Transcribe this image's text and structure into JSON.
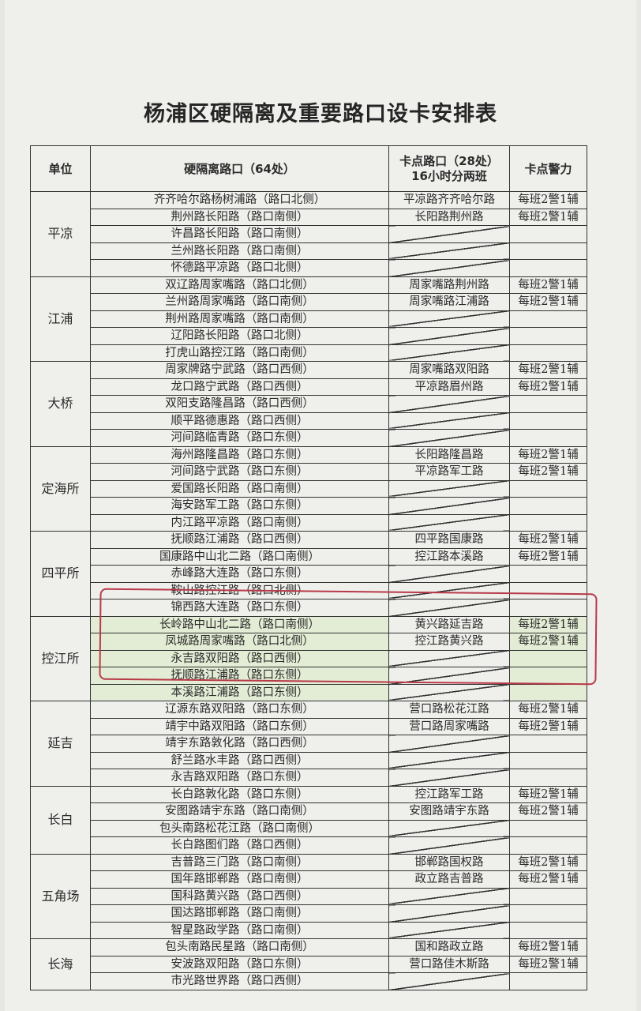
{
  "title": "杨浦区硬隔离及重要路口设卡安排表",
  "headers": {
    "unit": "单位",
    "road": "硬隔离路口（64处）",
    "checkpoint_line1": "卡点路口（28处）",
    "checkpoint_line2": "16小时分两班",
    "police": "卡点警力"
  },
  "groups": [
    {
      "unit": "平凉",
      "rows": [
        {
          "road": "齐齐哈尔路杨树浦路（路口北侧）",
          "cp": "平凉路齐齐哈尔路",
          "police": "每班2警1辅"
        },
        {
          "road": "荆州路长阳路（路口南侧）",
          "cp": "长阳路荆州路",
          "police": "每班2警1辅"
        },
        {
          "road": "许昌路长阳路（路口南侧）",
          "cp": "",
          "police": ""
        },
        {
          "road": "兰州路长阳路（路口南侧）",
          "cp": "",
          "police": ""
        },
        {
          "road": "怀德路平凉路（路口北侧）",
          "cp": "",
          "police": ""
        }
      ]
    },
    {
      "unit": "江浦",
      "rows": [
        {
          "road": "双辽路周家嘴路（路口北侧）",
          "cp": "周家嘴路荆州路",
          "police": "每班2警1辅"
        },
        {
          "road": "兰州路周家嘴路（路口南侧）",
          "cp": "周家嘴路江浦路",
          "police": "每班2警1辅"
        },
        {
          "road": "荆州路周家嘴路（路口南侧）",
          "cp": "",
          "police": ""
        },
        {
          "road": "辽阳路长阳路（路口北侧）",
          "cp": "",
          "police": ""
        },
        {
          "road": "打虎山路控江路（路口南侧）",
          "cp": "",
          "police": ""
        }
      ]
    },
    {
      "unit": "大桥",
      "rows": [
        {
          "road": "周家牌路宁武路（路口西侧）",
          "cp": "周家嘴路双阳路",
          "police": "每班2警1辅"
        },
        {
          "road": "龙口路宁武路（路口西侧）",
          "cp": "平凉路眉州路",
          "police": "每班2警1辅"
        },
        {
          "road": "双阳支路隆昌路（路口西侧）",
          "cp": "",
          "police": ""
        },
        {
          "road": "顺平路德惠路（路口西侧）",
          "cp": "",
          "police": ""
        },
        {
          "road": "河间路临青路（路口东侧）",
          "cp": "",
          "police": ""
        }
      ]
    },
    {
      "unit": "定海所",
      "rows": [
        {
          "road": "海州路隆昌路（路口东侧）",
          "cp": "长阳路隆昌路",
          "police": "每班2警1辅"
        },
        {
          "road": "河间路宁武路（路口东侧）",
          "cp": "平凉路军工路",
          "police": "每班2警1辅"
        },
        {
          "road": "爱国路长阳路（路口南侧）",
          "cp": "",
          "police": ""
        },
        {
          "road": "海安路军工路（路口东侧）",
          "cp": "",
          "police": ""
        },
        {
          "road": "内江路平凉路（路口南侧）",
          "cp": "",
          "police": ""
        }
      ]
    },
    {
      "unit": "四平所",
      "rows": [
        {
          "road": "抚顺路江浦路（路口西侧）",
          "cp": "四平路国康路",
          "police": "每班2警1辅"
        },
        {
          "road": "国康路中山北二路（路口南侧）",
          "cp": "控江路本溪路",
          "police": "每班2警1辅"
        },
        {
          "road": "赤峰路大连路（路口东侧）",
          "cp": "",
          "police": ""
        },
        {
          "road": "鞍山路控江路（路口北侧）",
          "cp": "",
          "police": ""
        },
        {
          "road": "锦西路大连路（路口东侧）",
          "cp": "",
          "police": ""
        }
      ]
    },
    {
      "unit": "控江所",
      "rows": [
        {
          "road": "长岭路中山北二路（路口南侧）",
          "cp": "黄兴路延吉路",
          "police": "每班2警1辅"
        },
        {
          "road": "凤城路周家嘴路（路口北侧）",
          "cp": "控江路黄兴路",
          "police": "每班2警1辅"
        },
        {
          "road": "永吉路双阳路（路口西侧）",
          "cp": "",
          "police": ""
        },
        {
          "road": "抚顺路江浦路（路口东侧）",
          "cp": "",
          "police": ""
        },
        {
          "road": "本溪路江浦路（路口东侧）",
          "cp": "",
          "police": ""
        }
      ]
    },
    {
      "unit": "延吉",
      "rows": [
        {
          "road": "辽源东路双阳路（路口东侧）",
          "cp": "营口路松花江路",
          "police": "每班2警1辅"
        },
        {
          "road": "靖宇中路双阳路（路口东侧）",
          "cp": "营口路周家嘴路",
          "police": "每班2警1辅"
        },
        {
          "road": "靖宇东路敦化路（路口西侧）",
          "cp": "",
          "police": ""
        },
        {
          "road": "舒兰路水丰路（路口西侧）",
          "cp": "",
          "police": ""
        },
        {
          "road": "永吉路双阳路（路口东侧）",
          "cp": "",
          "police": ""
        }
      ]
    },
    {
      "unit": "长白",
      "rows": [
        {
          "road": "长白路敦化路（路口东侧）",
          "cp": "控江路军工路",
          "police": "每班2警1辅"
        },
        {
          "road": "安图路靖宇东路（路口南侧）",
          "cp": "安图路靖宇东路",
          "police": "每班2警1辅"
        },
        {
          "road": "包头南路松花江路（路口南侧）",
          "cp": "",
          "police": ""
        },
        {
          "road": "长白路图们路（路口西侧）",
          "cp": "",
          "police": ""
        }
      ]
    },
    {
      "unit": "五角场",
      "rows": [
        {
          "road": "吉普路三门路（路口南侧）",
          "cp": "邯郸路国权路",
          "police": "每班2警1辅"
        },
        {
          "road": "国年路邯郸路（路口南侧）",
          "cp": "政立路吉普路",
          "police": "每班2警1辅"
        },
        {
          "road": "国科路黄兴路（路口西侧）",
          "cp": "",
          "police": ""
        },
        {
          "road": "国达路邯郸路（路口南侧）",
          "cp": "",
          "police": ""
        },
        {
          "road": "智星路政学路（路口南侧）",
          "cp": "",
          "police": ""
        }
      ]
    },
    {
      "unit": "长海",
      "rows": [
        {
          "road": "包头南路民星路（路口南侧）",
          "cp": "国和路政立路",
          "police": "每班2警1辅"
        },
        {
          "road": "安波路双阳路（路口东侧）",
          "cp": "营口路佳木斯路",
          "police": "每班2警1辅"
        },
        {
          "road": "市光路世界路（路口西侧）",
          "cp": "",
          "police": ""
        }
      ]
    }
  ]
}
